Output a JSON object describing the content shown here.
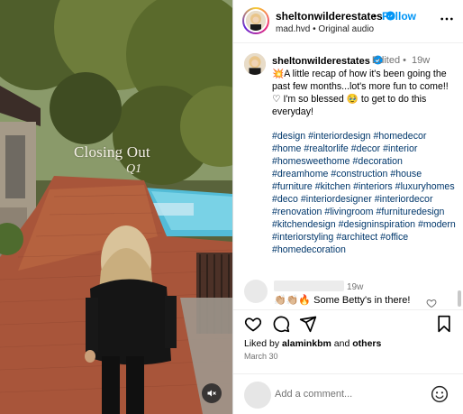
{
  "video": {
    "overlay_title": "Closing Out",
    "overlay_subtitle": "Q1"
  },
  "header": {
    "username": "sheltonwilderestates",
    "separator": "•",
    "follow_label": "Follow",
    "audio": "mad.hvd • Original audio"
  },
  "caption": {
    "username": "sheltonwilderestates",
    "edited": "• Edited •",
    "time": "19w",
    "text": "💥A little recap of how it's been going the past few months...lot's more fun to come!! ♡ I'm so blessed 🥹 to get to do this everyday!",
    "hashtags": [
      "#design",
      "#interiordesign",
      "#homedecor",
      "#home",
      "#realtorlife",
      "#decor",
      "#interior",
      "#homesweethome",
      "#decoration",
      "#dreamhome",
      "#construction",
      "#house",
      "#furniture",
      "#kitchen",
      "#interiors",
      "#luxuryhomes",
      "#deco",
      "#interiordesigner",
      "#interiordecor",
      "#renovation",
      "#livingroom",
      "#furnituredesign",
      "#kitchendesign",
      "#designinspiration",
      "#modern",
      "#interiorstyling",
      "#architect",
      "#office",
      "#homedecoration"
    ]
  },
  "comment": {
    "time": "19w",
    "text": "👏🏼👏🏼🔥 Some Betty's in there!"
  },
  "likes": {
    "prefix": "Liked by ",
    "user": "alaminkbm",
    "middle": " and ",
    "others": "others"
  },
  "post_date": "March 30",
  "add_comment": {
    "placeholder": "Add a comment..."
  },
  "colors": {
    "follow": "#0095f6",
    "hashtag": "#00376b",
    "secondary_text": "#737373",
    "verified": "#0095f6"
  },
  "icons": {
    "verified": "verified-badge-icon",
    "more": "more-options-icon",
    "like": "heart-icon",
    "comment": "comment-icon",
    "share": "share-icon",
    "save": "bookmark-icon",
    "emoji": "emoji-icon",
    "mute": "muted-speaker-icon"
  }
}
